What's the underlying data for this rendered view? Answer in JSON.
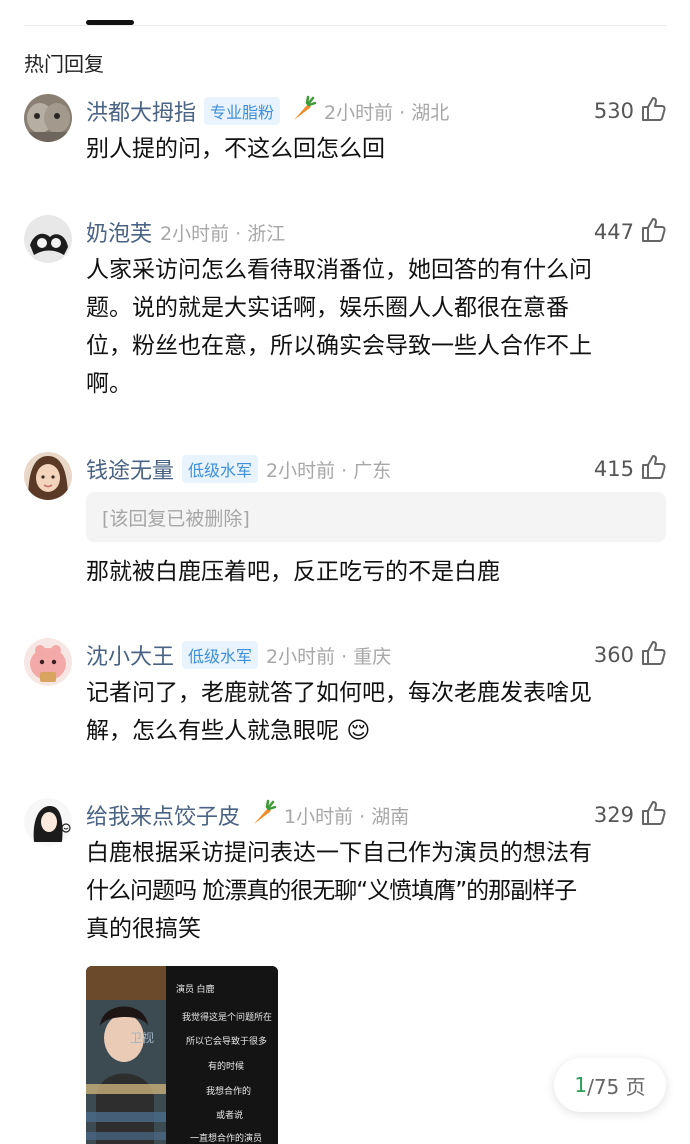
{
  "section_title": "热门回复",
  "comments": [
    {
      "username": "洪都大拇指",
      "badge": "专业脂粉",
      "carrot_icon": "carrot-icon",
      "time": "2小时前 · 湖北",
      "likes": "530",
      "text": "别人提的问，不这么回怎么回"
    },
    {
      "username": "奶泡芙",
      "time": "2小时前 · 浙江",
      "likes": "447",
      "text_lines": [
        "人家采访问怎么看待取消番位，她回答的有什么问",
        "题。说的就是大实话啊，娱乐圈人人都很在意番",
        "位，粉丝也在意，所以确实会导致一些人合作不上",
        "啊。"
      ]
    },
    {
      "username": "钱途无量",
      "badge": "低级水军",
      "time": "2小时前 · 广东",
      "likes": "415",
      "deleted": "[该回复已被删除]",
      "text": "那就被白鹿压着吧，反正吃亏的不是白鹿"
    },
    {
      "username": "沈小大王",
      "badge": "低级水军",
      "time": "2小时前 · 重庆",
      "likes": "360",
      "text_lines": [
        "记者问了，老鹿就答了如何吧，每次老鹿发表啥见",
        "解，怎么有些人就急眼呢"
      ],
      "emoji": "😌"
    },
    {
      "username": "给我来点饺子皮",
      "carrot_icon": "carrot-icon",
      "time": "1小时前 · 湖南",
      "likes": "329",
      "text_lines": [
        "白鹿根据采访提问表达一下自己作为演员的想法有",
        "什么问题吗 尬漂真的很无聊“义愤填膺”的那副样子",
        "真的很搞笑"
      ],
      "image": {
        "logo": "卫视",
        "right_lines": [
          "演员 白鹿",
          "我觉得这是个问题所在",
          "所以它会导致于很多",
          "有的时候",
          "我想合作的",
          "或者说",
          "一直想合作的演员"
        ]
      }
    }
  ],
  "pager": {
    "current": "1",
    "total_text": "/75 页"
  }
}
